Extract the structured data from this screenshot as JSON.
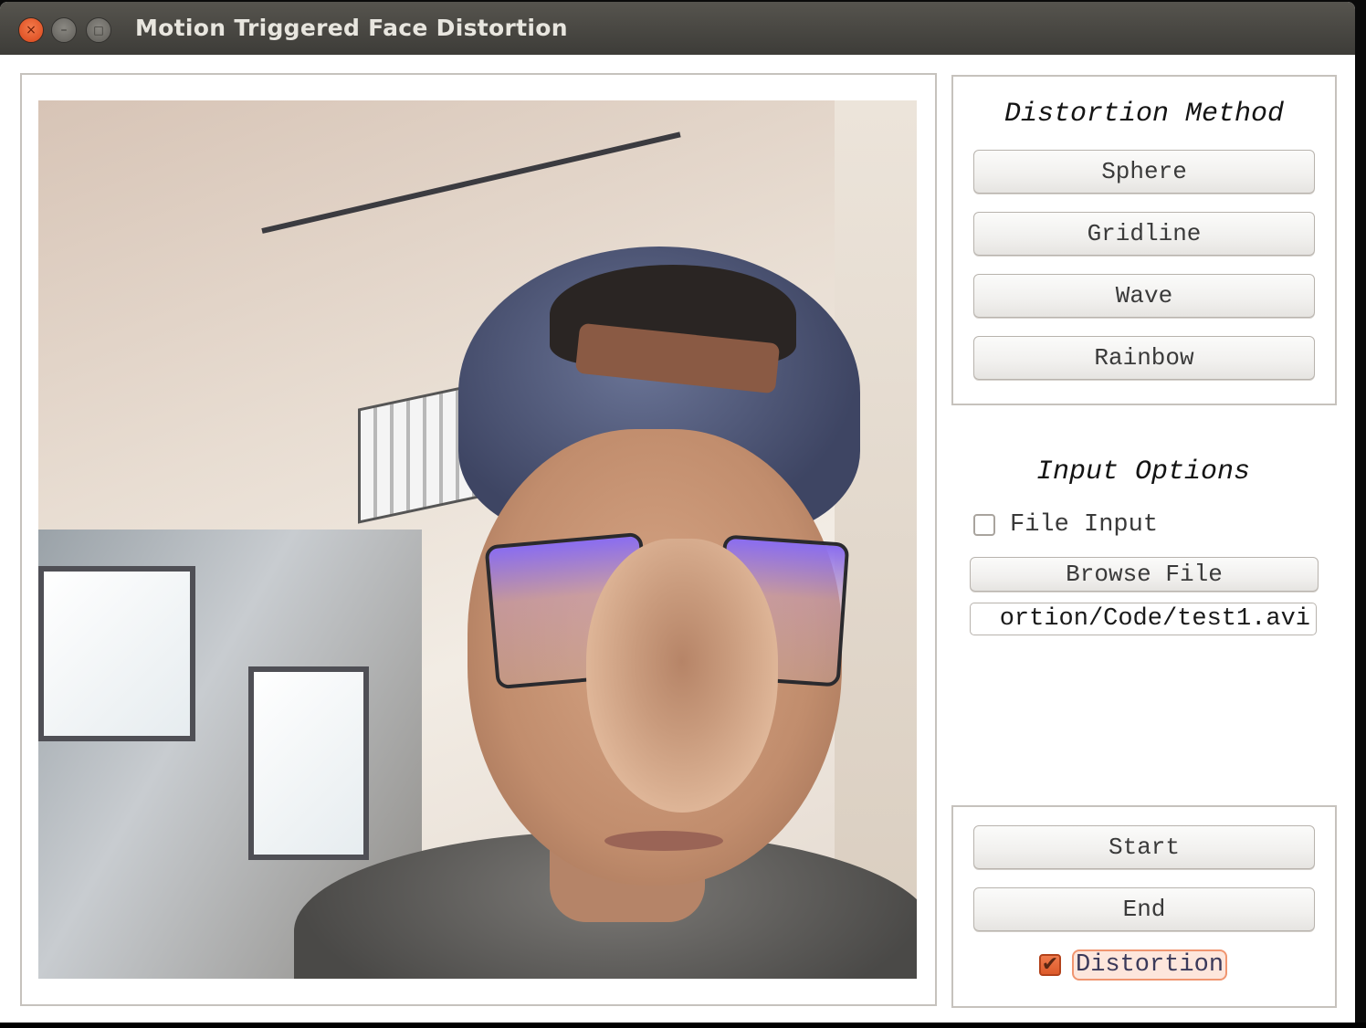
{
  "window": {
    "title": "Motion Triggered Face Distortion",
    "controls": {
      "close": "×",
      "minimize": "–",
      "maximize": "□"
    }
  },
  "video": {
    "description": "Live webcam feed with face distortion applied (sphere-distorted nose)"
  },
  "distortion_method": {
    "title": "Distortion Method",
    "buttons": [
      {
        "label": "Sphere"
      },
      {
        "label": "Gridline"
      },
      {
        "label": "Wave"
      },
      {
        "label": "Rainbow"
      }
    ]
  },
  "input_options": {
    "title": "Input Options",
    "file_input_checkbox": {
      "label": "File Input",
      "checked": false
    },
    "browse_button": {
      "label": "Browse File"
    },
    "file_path": {
      "value": "ortion/Code/test1.avi"
    }
  },
  "controls": {
    "start_button": {
      "label": "Start"
    },
    "end_button": {
      "label": "End"
    },
    "distortion_checkbox": {
      "label": "Distortion",
      "checked": true,
      "check_glyph": "✔"
    }
  },
  "colors": {
    "accent": "#dd5a2a",
    "focus_fill": "#fde6dc",
    "titlebar": "#3d3c38"
  }
}
